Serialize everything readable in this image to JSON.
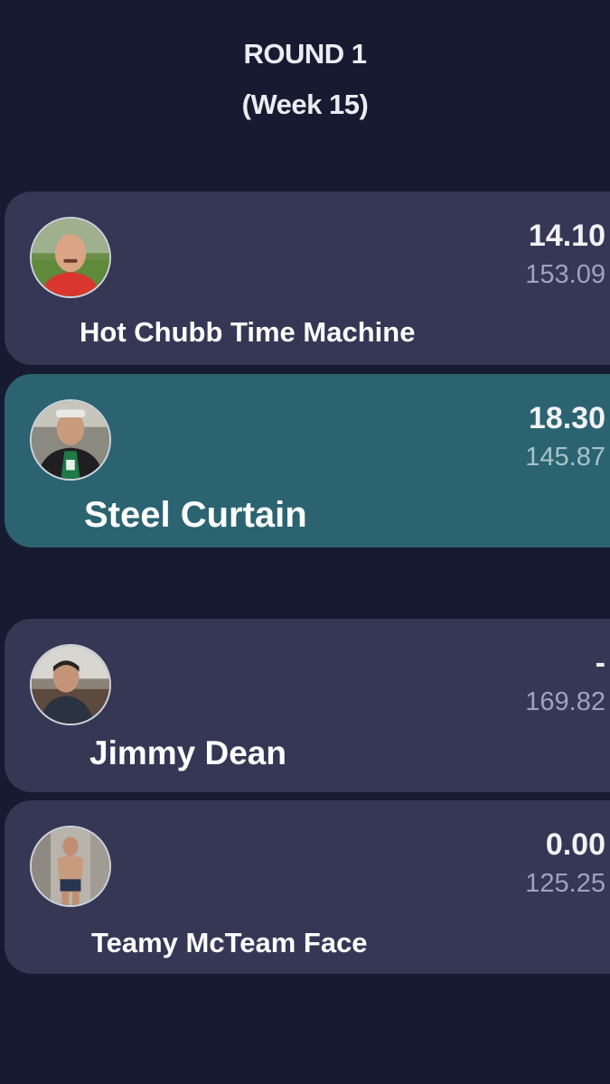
{
  "header": {
    "round": "ROUND 1",
    "week": "(Week 15)"
  },
  "matchups": [
    {
      "team": "Hot Chubb Time Machine",
      "score": "14.10",
      "projected": "153.09",
      "winner": false
    },
    {
      "team": "Steel Curtain",
      "score": "18.30",
      "projected": "145.87",
      "winner": true
    },
    {
      "team": "Jimmy Dean",
      "score": "-",
      "projected": "169.82",
      "winner": false
    },
    {
      "team": "Teamy McTeam Face",
      "score": "0.00",
      "projected": "125.25",
      "winner": false
    }
  ],
  "colors": {
    "background": "#171a30",
    "card": "#353755",
    "winner_card": "#2b6371"
  }
}
